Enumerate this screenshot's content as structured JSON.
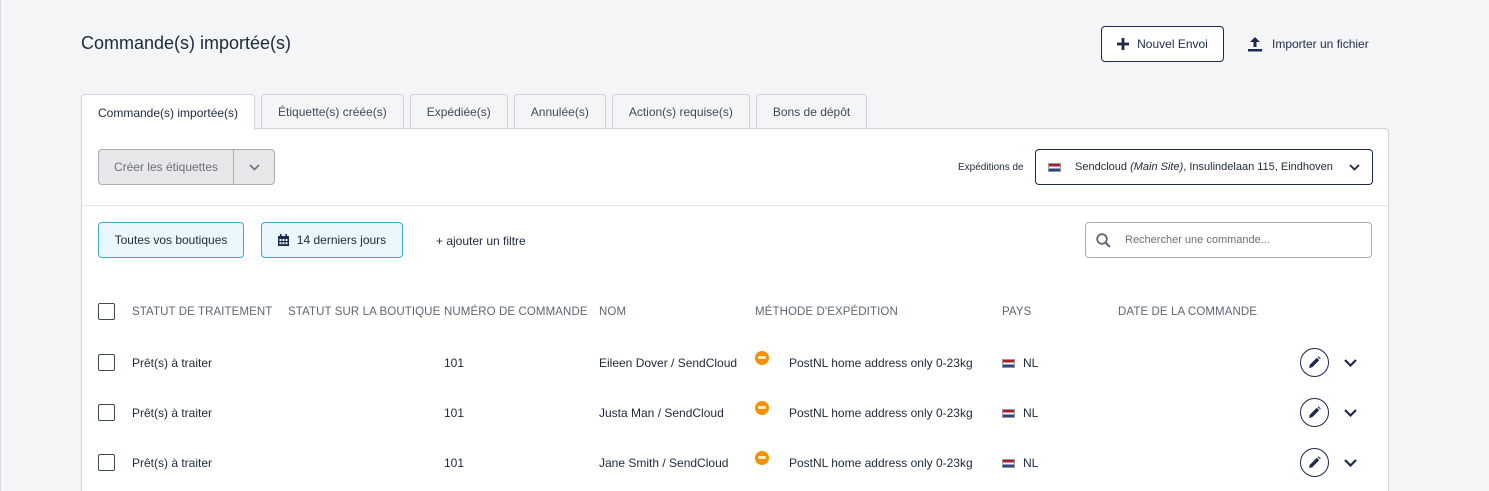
{
  "header": {
    "title": "Commande(s) importée(s)",
    "new_shipment_label": "Nouvel Envoi",
    "import_label": "Importer un fichier"
  },
  "tabs": [
    {
      "label": "Commande(s) importée(s)",
      "active": true
    },
    {
      "label": "Étiquette(s) créée(s)",
      "active": false
    },
    {
      "label": "Expédiée(s)",
      "active": false
    },
    {
      "label": "Annulée(s)",
      "active": false
    },
    {
      "label": "Action(s) requise(s)",
      "active": false
    },
    {
      "label": "Bons de dépôt",
      "active": false
    }
  ],
  "toolbar": {
    "create_labels": "Créer les étiquettes",
    "ship_from_label": "Expéditions de",
    "ship_from": {
      "name": "Sendcloud",
      "site": "(Main Site)",
      "address": ", Insulindelaan 115, Eindhoven"
    }
  },
  "filters": {
    "shops": "Toutes vos boutiques",
    "period": "14 derniers jours",
    "add_filter": "+ ajouter un filtre",
    "search_placeholder": "Rechercher une commande..."
  },
  "table": {
    "columns": {
      "status": "STATUT DE TRAITEMENT",
      "shop_status": "STATUT SUR LA BOUTIQUE",
      "order_number": "NUMÉRO DE COMMANDE",
      "name": "NOM",
      "shipping_method": "MÉTHODE D'EXPÉDITION",
      "country": "PAYS",
      "order_date": "DATE DE LA COMMANDE"
    },
    "rows": [
      {
        "status": "Prêt(s) à traiter",
        "shop_status": "",
        "order_number": "101",
        "name": "Eileen Dover / SendCloud",
        "shipping_method": "PostNL home address only 0-23kg",
        "country": "NL",
        "order_date": ""
      },
      {
        "status": "Prêt(s) à traiter",
        "shop_status": "",
        "order_number": "101",
        "name": "Justa Man / SendCloud",
        "shipping_method": "PostNL home address only 0-23kg",
        "country": "NL",
        "order_date": ""
      },
      {
        "status": "Prêt(s) à traiter",
        "shop_status": "",
        "order_number": "101",
        "name": "Jane Smith / SendCloud",
        "shipping_method": "PostNL home address only 0-23kg",
        "country": "NL",
        "order_date": ""
      }
    ]
  },
  "colors": {
    "primary": "#1c2a4d",
    "chip_border": "#3da9d6",
    "chip_bg": "#eaf7fc",
    "postnl": "#f39200"
  },
  "icons": {
    "new": "plus-icon",
    "import": "upload-icon",
    "calendar": "calendar-icon",
    "search": "search-icon",
    "edit": "pencil-icon",
    "expand": "chevron-down-icon",
    "carrier": "postnl-icon",
    "flag": "netherlands-flag-icon"
  }
}
